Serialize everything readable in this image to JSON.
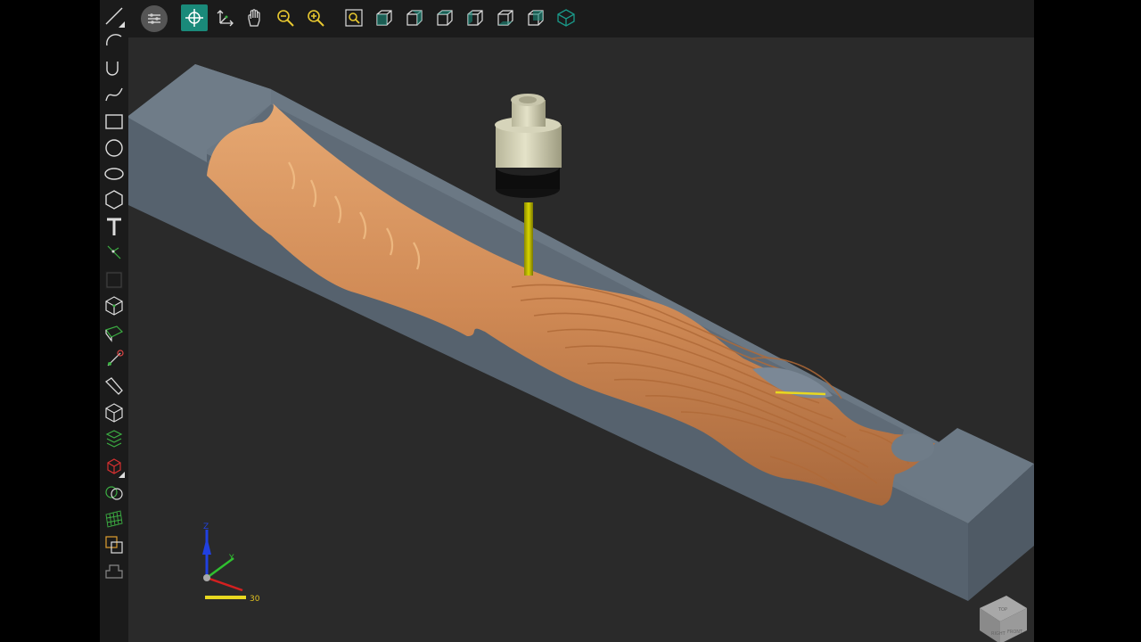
{
  "toolbar_top": {
    "tools": [
      {
        "id": "settings",
        "icon": "sliders-icon"
      },
      {
        "id": "select",
        "icon": "crosshair-select-icon",
        "active": true
      },
      {
        "id": "pan-axes",
        "icon": "axes-move-icon"
      },
      {
        "id": "pan-hand",
        "icon": "hand-icon"
      },
      {
        "id": "zoom-out",
        "icon": "zoom-out-icon"
      },
      {
        "id": "zoom-in",
        "icon": "zoom-in-icon"
      },
      {
        "id": "zoom-window",
        "icon": "zoom-window-icon"
      },
      {
        "id": "view-iso",
        "icon": "view-cube-icon"
      },
      {
        "id": "view-front",
        "icon": "view-cube-icon"
      },
      {
        "id": "view-back",
        "icon": "view-cube-icon"
      },
      {
        "id": "view-left",
        "icon": "view-cube-icon"
      },
      {
        "id": "view-right",
        "icon": "view-cube-icon"
      },
      {
        "id": "view-top",
        "icon": "view-cube-icon"
      },
      {
        "id": "view-bottom",
        "icon": "view-cube-icon"
      }
    ]
  },
  "toolbar_left": {
    "tools": [
      "line-icon",
      "arc-icon",
      "u-curve-icon",
      "spline-icon",
      "rectangle-icon",
      "circle-icon",
      "ellipse-icon",
      "polygon-icon",
      "text-icon",
      "point-icon",
      "square-icon",
      "solid-box-icon",
      "surface-icon",
      "transform-icon",
      "pencil-icon",
      "wireframe-icon",
      "stack-icon",
      "red-solid-icon",
      "boolean-icon",
      "mesh-icon",
      "layers-icon",
      "fixture-icon"
    ]
  },
  "triad": {
    "axis_labels": {
      "z": "Z",
      "y": "Y"
    },
    "scale_label": "30",
    "colors": {
      "x": "#d42020",
      "y": "#30c030",
      "z": "#2040e0",
      "scale": "#e8d820"
    }
  },
  "view_cube": {
    "face_labels": [
      "RIGHT",
      "FRONT",
      "TOP"
    ]
  },
  "scene": {
    "stock_color": "#6e7c88",
    "part_color": "#d49460",
    "tool_shank_color": "#cfcdb2",
    "tool_flute_color": "#c8c400",
    "accent_color": "#1a8a7a"
  }
}
